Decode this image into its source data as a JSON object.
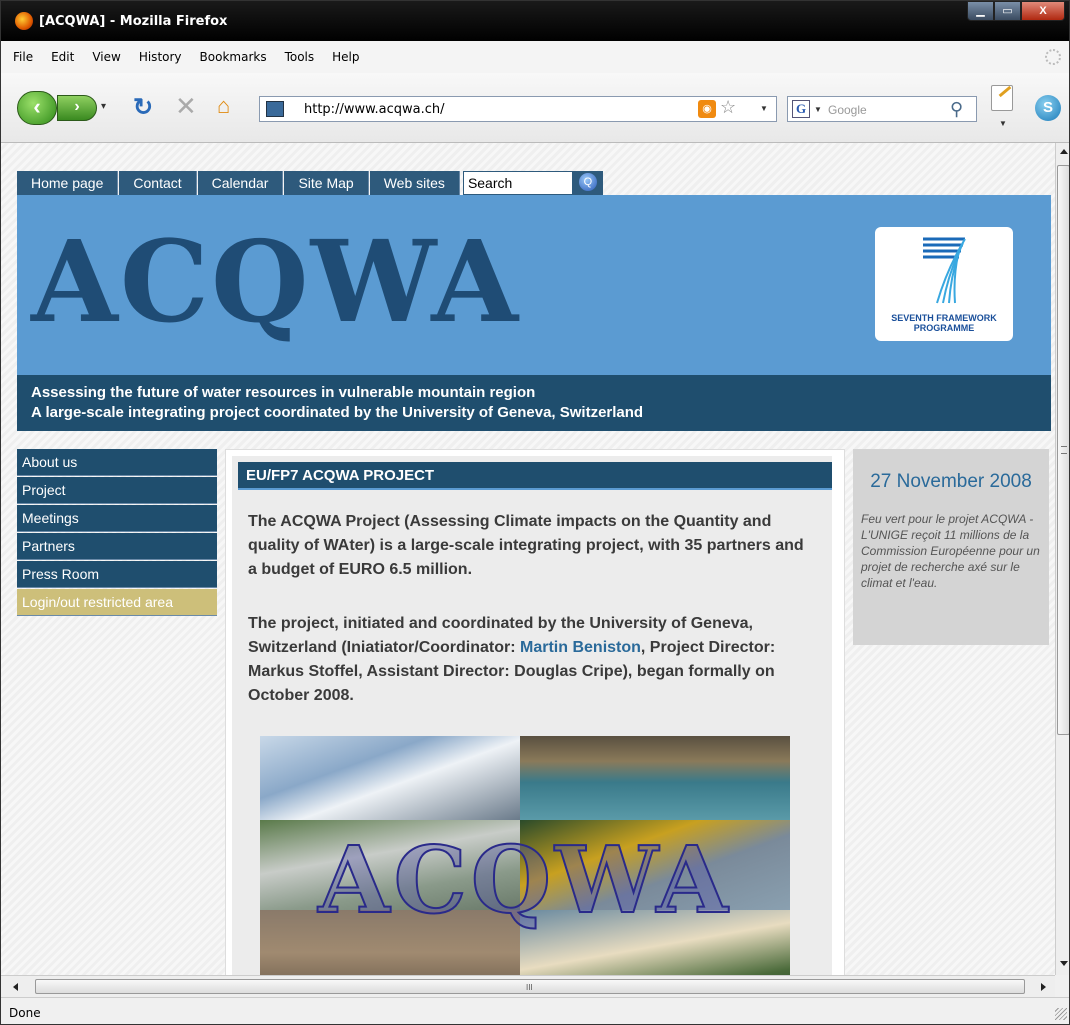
{
  "window": {
    "title": "[ACQWA] - Mozilla Firefox",
    "controls": {
      "minimize": "▁",
      "maximize": "▭",
      "close": "X"
    }
  },
  "menu": [
    "File",
    "Edit",
    "View",
    "History",
    "Bookmarks",
    "Tools",
    "Help"
  ],
  "toolbar": {
    "url": "http://www.acqwa.ch/",
    "search_placeholder": "Google"
  },
  "site": {
    "topnav": [
      "Home page",
      "Contact",
      "Calendar",
      "Site Map",
      "Web sites"
    ],
    "search_label": "Search",
    "logo_text": "ACQWA",
    "fp7": {
      "line1": "SEVENTH FRAMEWORK",
      "line2": "PROGRAMME"
    },
    "tagline": {
      "line1": "Assessing the future of water resources in vulnerable mountain region",
      "line2": "A large-scale integrating project coordinated by the University of Geneva, Switzerland"
    },
    "sidenav": [
      "About us",
      "Project",
      "Meetings",
      "Partners",
      "Press Room",
      "Login/out restricted area"
    ],
    "main": {
      "heading": "EU/FP7 ACQWA PROJECT",
      "para1": "The ACQWA Project (Assessing Climate impacts on the Quantity and quality of WAter) is a large-scale integrating project, with 35 partners and a budget of EURO 6.5 million.",
      "para2_before": "The project, initiated and coordinated by the University of Geneva, Switzerland (Iniatiator/Coordinator: ",
      "para2_link": "Martin Beniston",
      "para2_after": ", Project Director: Markus Stoffel, Assistant Director: Douglas Cripe), began formally on October 2008.",
      "photo_logo": "ACQWA"
    },
    "news": {
      "date": "27 November 2008",
      "text": "Feu vert pour le projet ACQWA - L'UNIGE reçoit 11 millions de la Commission Européenne pour un projet de recherche axé sur le climat et l'eau."
    }
  },
  "status": {
    "text": "Done"
  },
  "colors": {
    "nav_dark": "#1f4e6e",
    "banner_blue": "#5b9bd2",
    "restricted": "#cdbf7a",
    "link": "#2a6a9a"
  }
}
